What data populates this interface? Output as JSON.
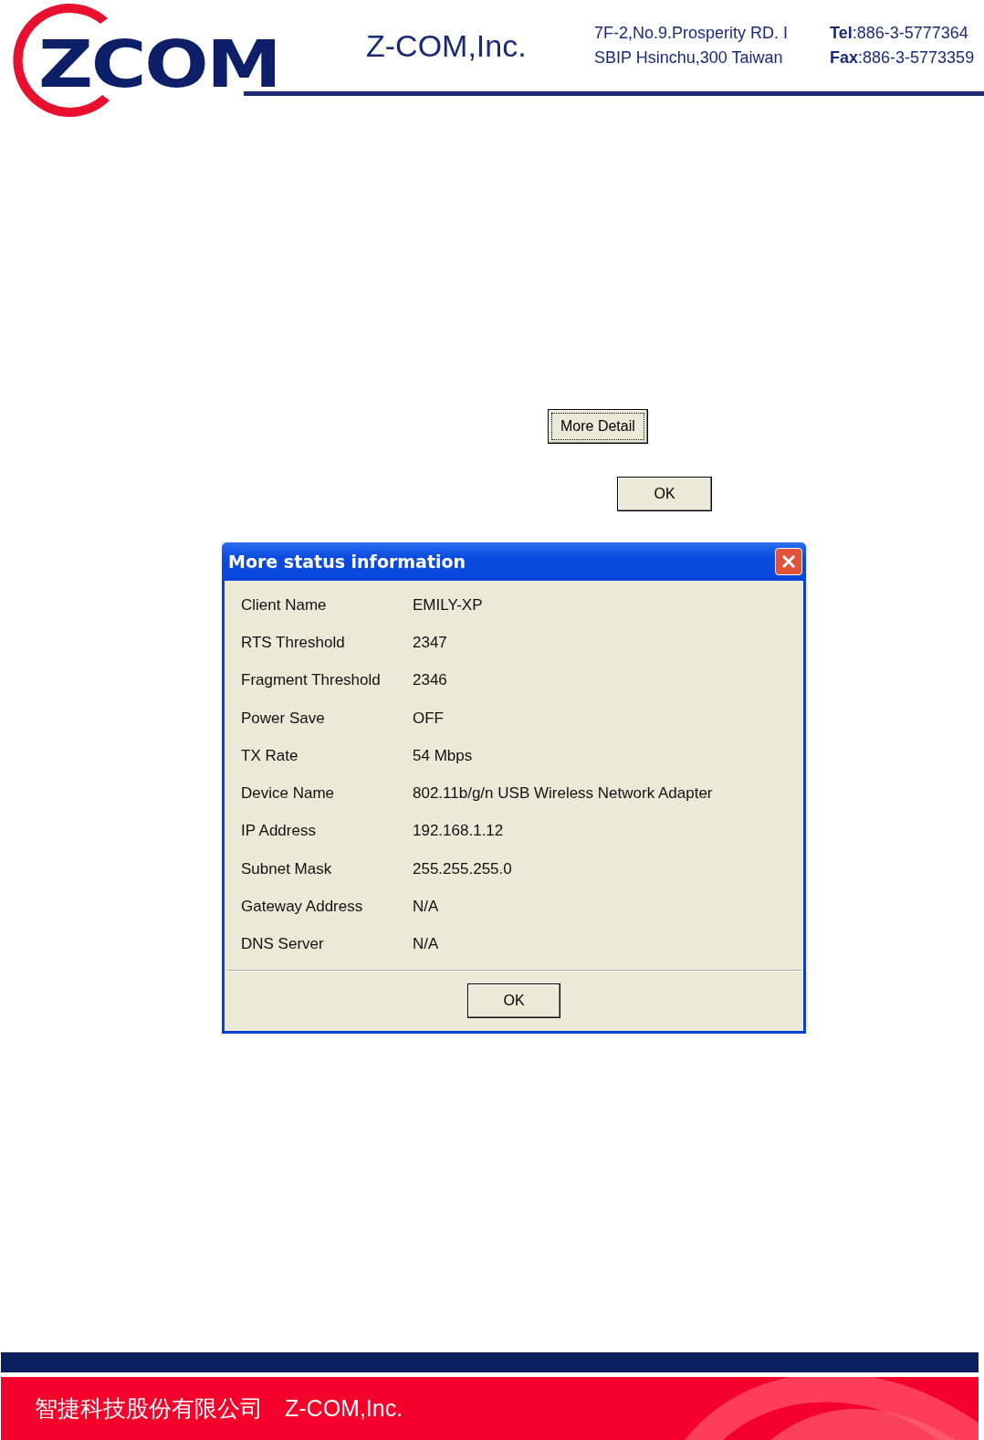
{
  "header": {
    "logo_text": "ZCOM",
    "company": "Z-COM,Inc.",
    "address_lines": [
      "7F-2,No.9.Prosperity RD. I",
      "SBIP Hsinchu,300 Taiwan"
    ],
    "contacts": [
      {
        "label": "Tel",
        "value": ":886-3-5777364"
      },
      {
        "label": "Fax",
        "value": ":886-3-5773359"
      }
    ]
  },
  "buttons": [
    {
      "label": "More Detail",
      "focused": true
    },
    {
      "label": "OK",
      "focused": false
    }
  ],
  "dialog": {
    "title": "More status information",
    "rows": [
      {
        "label": "Client Name",
        "value": "EMILY-XP"
      },
      {
        "label": "RTS Threshold",
        "value": "2347"
      },
      {
        "label": "Fragment Threshold",
        "value": "2346"
      },
      {
        "label": "Power Save",
        "value": "OFF"
      },
      {
        "label": "TX Rate",
        "value": "54 Mbps"
      },
      {
        "label": "Device Name",
        "value": "802.11b/g/n USB Wireless Network Adapter"
      },
      {
        "label": "IP Address",
        "value": "192.168.1.12"
      },
      {
        "label": "Subnet Mask",
        "value": "255.255.255.0"
      },
      {
        "label": "Gateway Address",
        "value": "N/A"
      },
      {
        "label": "DNS Server",
        "value": "N/A"
      }
    ],
    "ok": "OK"
  },
  "footer": {
    "chinese": "智捷科技股份有限公司",
    "company": "Z-COM,Inc."
  }
}
